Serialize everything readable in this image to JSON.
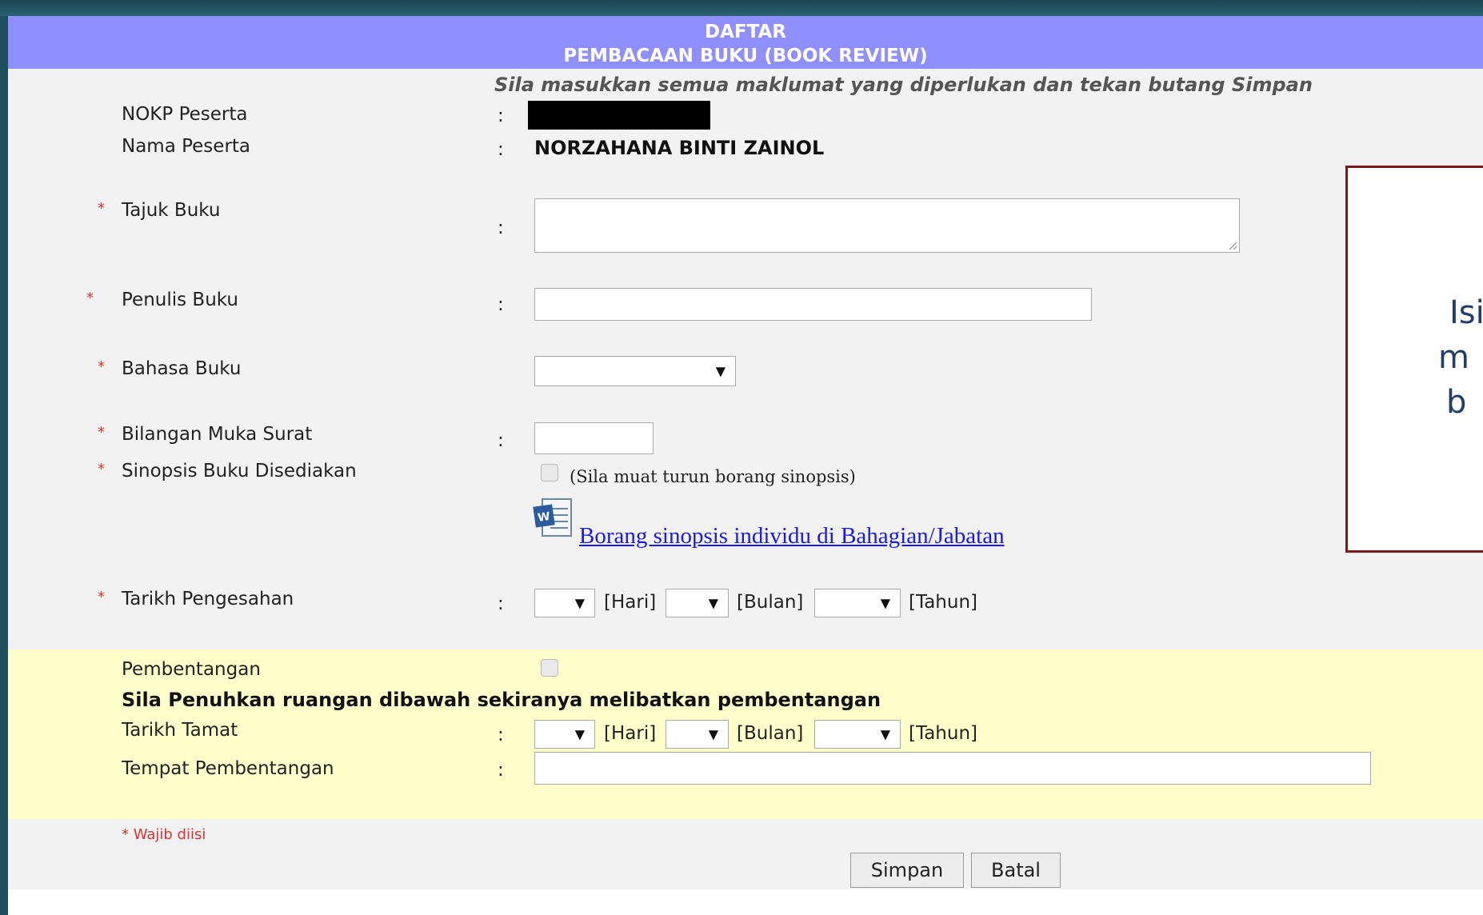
{
  "header": {
    "line1": "DAFTAR",
    "line2": "PEMBACAAN BUKU (BOOK REVIEW)"
  },
  "instruction": "Sila masukkan semua maklumat yang diperlukan dan tekan butang Simpan",
  "colon": ":",
  "required_mark": "*",
  "fields": {
    "nokp_label": "NOKP Peserta",
    "nama_label": "Nama Peserta",
    "nama_value": "NORZAHANA BINTI ZAINOL",
    "tajuk_label": "Tajuk Buku",
    "tajuk_value": "",
    "penulis_label": "Penulis Buku",
    "penulis_value": "",
    "bahasa_label": "Bahasa Buku",
    "bahasa_value": "",
    "bilangan_label": "Bilangan Muka Surat",
    "bilangan_value": "",
    "sinopsis_label": "Sinopsis Buku Disediakan",
    "sinopsis_note": "(Sila muat turun borang sinopsis)",
    "sinopsis_link": "Borang sinopsis individu di Bahagian/Jabatan",
    "tarikh_pengesahan_label": "Tarikh Pengesahan"
  },
  "date_units": {
    "hari": "[Hari]",
    "bulan": "[Bulan]",
    "tahun": "[Tahun]"
  },
  "presentation": {
    "pembentangan_label": "Pembentangan",
    "note": "Sila Penuhkan ruangan dibawah sekiranya melibatkan pembentangan",
    "tarikh_tamat_label": "Tarikh Tamat",
    "tempat_label": "Tempat Pembentangan",
    "tempat_value": ""
  },
  "required_note": "* Wajib diisi",
  "buttons": {
    "save": "Simpan",
    "cancel": "Batal"
  },
  "callout": {
    "line1": "Isi",
    "line2": "m",
    "line3": "b"
  },
  "icons": {
    "dropdown": "triangle-down",
    "word": "word-document-icon"
  },
  "colors": {
    "header": "#8f8fff",
    "required": "#e03030",
    "link": "#1a1aee",
    "highlight": "#ffffcc"
  }
}
